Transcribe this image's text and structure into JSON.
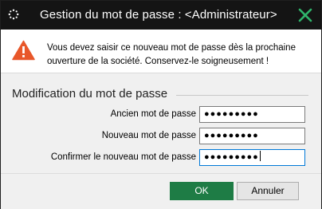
{
  "window": {
    "title": "Gestion du mot de passe : <Administrateur>",
    "app_icon": "app-dots-icon",
    "close_icon": "close-icon",
    "titlebar_color": "#141414",
    "accent_green": "#1e7c45"
  },
  "banner": {
    "icon": "warning-icon",
    "icon_color": "#e8572a",
    "message": "Vous devez saisir ce nouveau mot de passe dès la prochaine ouverture de la société. Conservez-le soigneusement !"
  },
  "form": {
    "group_title": "Modification du mot de passe",
    "fields": [
      {
        "label": "Ancien mot de passe",
        "value": "●●●●●●●●●"
      },
      {
        "label": "Nouveau mot de passe",
        "value": "●●●●●●●●●"
      },
      {
        "label": "Confirmer le nouveau mot de passe",
        "value": "●●●●●●●●●"
      }
    ]
  },
  "buttons": {
    "ok": "OK",
    "cancel": "Annuler"
  }
}
